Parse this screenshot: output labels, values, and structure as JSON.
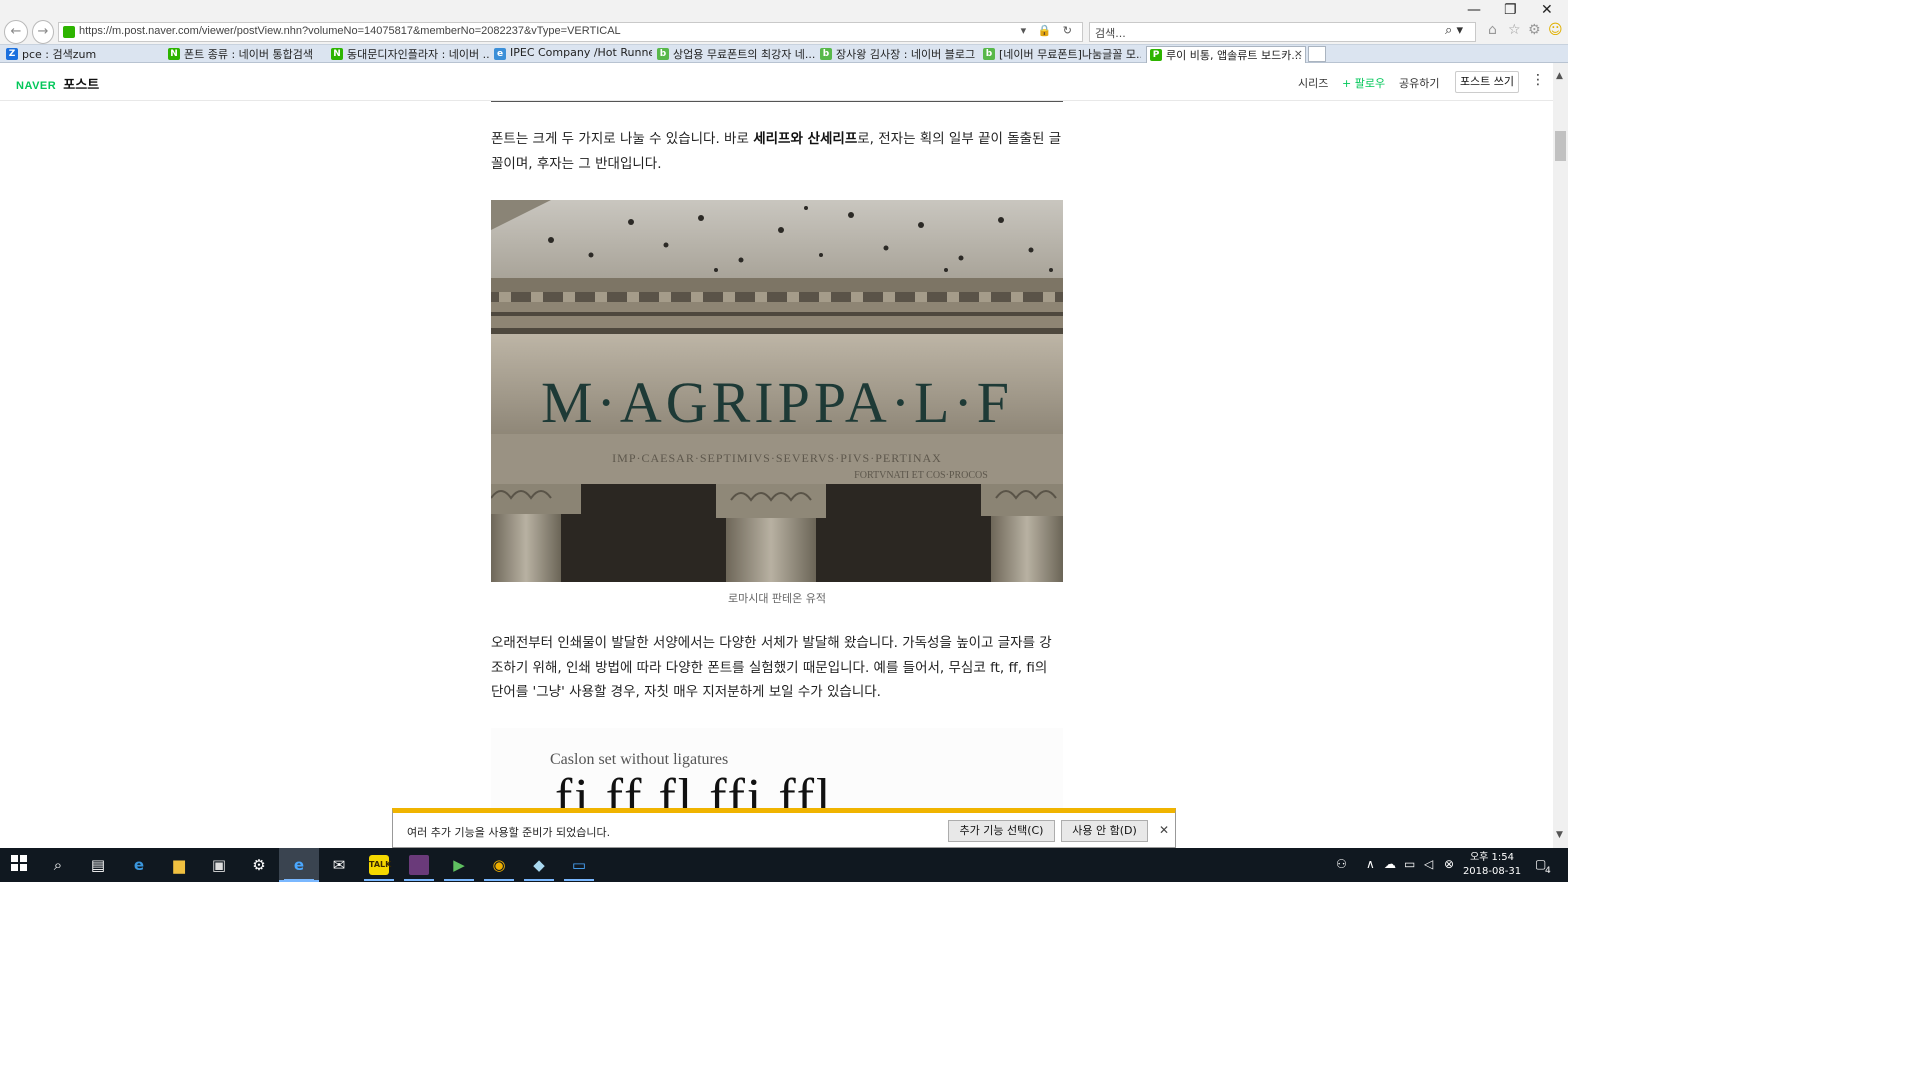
{
  "browser": {
    "url": "https://m.post.naver.com/viewer/postView.nhn?volumeNo=14075817&memberNo=2082237&vType=VERTICAL",
    "search_placeholder": "검색...",
    "favorites": [
      {
        "label": "pce : 검색zum",
        "icon": "zum-icon",
        "color": "#1a6fde",
        "glyph": "Z"
      },
      {
        "label": "폰트 종류 : 네이버 통합검색",
        "icon": "naver-icon",
        "color": "#2db400",
        "glyph": "N"
      },
      {
        "label": "동대문디자인플라자 : 네이버 ...",
        "icon": "naver-icon",
        "color": "#2db400",
        "glyph": "N"
      },
      {
        "label": "IPEC Company /Hot Runne...",
        "icon": "ie-page-icon",
        "color": "#3c8fd8",
        "glyph": "e"
      },
      {
        "label": "상업용 무료폰트의 최강자 네...",
        "icon": "naver-blog-icon",
        "color": "#58b84a",
        "glyph": "b"
      },
      {
        "label": "장사왕 김사장 : 네이버 블로그",
        "icon": "naver-blog-icon",
        "color": "#58b84a",
        "glyph": "b"
      },
      {
        "label": "[네이버 무료폰트]나눔글꼴 모...",
        "icon": "naver-blog-icon",
        "color": "#58b84a",
        "glyph": "b"
      },
      {
        "label": "루이 비통, 앱솔류트 보드카...",
        "icon": "naver-post-icon",
        "color": "#2db400",
        "glyph": "P"
      }
    ]
  },
  "header": {
    "logo_naver": "NAVER",
    "logo_post": "포스트",
    "series": "시리즈",
    "follow": "+ 팔로우",
    "share": "공유하기",
    "write": "포스트 쓰기"
  },
  "article": {
    "p1_a": "폰트는 크게 두 가지로 나눌 수 있습니다. 바로 ",
    "p1_b": "세리프와 산세리프",
    "p1_c": "로, 전자는 획의 일부 끝이 돌출된 글꼴이며, 후자는 그 반대입니다.",
    "photo_inscription": "M·AGRIPPA·L·F",
    "photo_inscription_2": "IMP·CAESAR·SEPTIMIVS·SEVERVS·PIVS·PERTINAX",
    "photo_inscription_3": "FORTVNATI ET COS·PROCOS",
    "caption": "로마시대 판테온 유적",
    "p2": "오래전부터 인쇄물이 발달한 서양에서는 다양한 서체가 발달해 왔습니다. 가독성을 높이고 글자를 강조하기 위해, 인쇄 방법에 따라 다양한 폰트를 실험했기 때문입니다. 예를 들어서, 무심코 ft, ff, fi의 단어를 '그냥' 사용할 경우, 자칫 매우 지저분하게 보일 수가 있습니다.",
    "lig_title": "Caslon set without ligatures",
    "lig_glyphs": "fi   ff   fl   ffi   ffl"
  },
  "notification": {
    "message": "여러 추가 기능을 사용할 준비가 되었습니다.",
    "choose_btn": "추가 기능 선택(C)",
    "disable_btn": "사용 안 함(D)"
  },
  "taskbar": {
    "time": "오후 1:54",
    "date": "2018-08-31",
    "notif_count": "4"
  }
}
